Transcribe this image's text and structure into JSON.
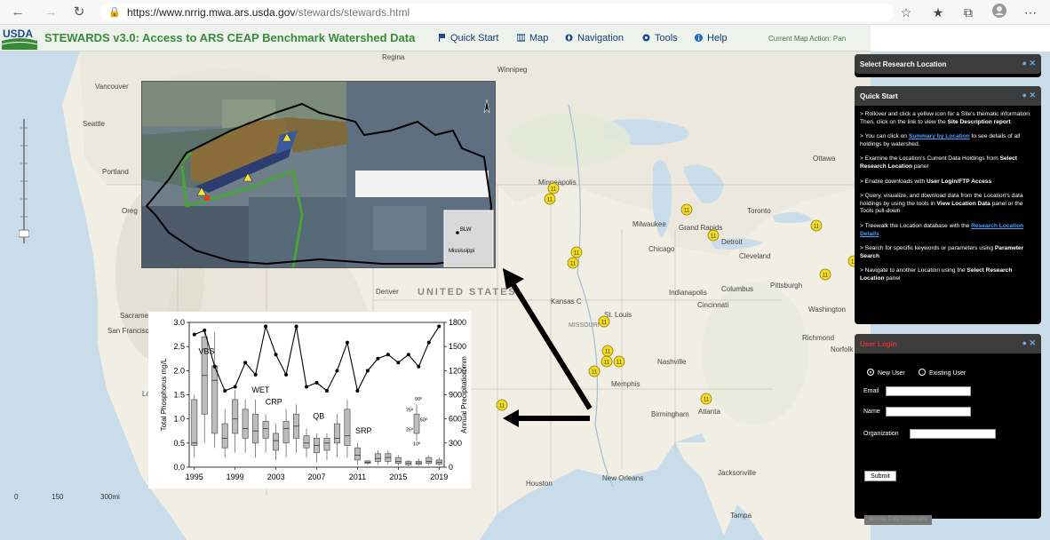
{
  "browser": {
    "url_domain": "https://www.nrrig.mwa.ars.usda.gov",
    "url_path": "/stewards/stewards.html"
  },
  "header": {
    "logo_text": "USDA",
    "title": "STEWARDS v3.0: Access to ARS CEAP Benchmark Watershed Data",
    "menu": [
      {
        "label": "Quick Start",
        "icon": "flag-icon"
      },
      {
        "label": "Map",
        "icon": "map-icon"
      },
      {
        "label": "Navigation",
        "icon": "compass-icon"
      },
      {
        "label": "Tools",
        "icon": "gear-icon"
      },
      {
        "label": "Help",
        "icon": "info-icon"
      }
    ],
    "map_action": "Current Map Action: Pan"
  },
  "map": {
    "labels": {
      "regina": "Regina",
      "winnipeg": "Winnipeg",
      "vancouver": "Vancouver",
      "seattle": "Seattle",
      "portland": "Portland",
      "oregon": "Oreg",
      "minneapolis": "Minneapolis",
      "toronto": "Toronto",
      "ottawa": "Ottawa",
      "milwaukee": "Milwaukee",
      "grand_rapids": "Grand Rapids",
      "detroit": "Detroit",
      "chicago": "Chicago",
      "cleveland": "Cleveland",
      "pittsburgh": "Pittsburgh",
      "columbus": "Columbus",
      "indianapolis": "Indianapolis",
      "cincinnati": "Cincinnati",
      "kansas": "Kansas C",
      "st_louis": "St. Louis",
      "missouri": "MISSOURI",
      "nashville": "Nashville",
      "memphis": "Memphis",
      "atlanta": "Atlanta",
      "birmingham": "Birmingham",
      "washington": "Washington",
      "richmond": "Richmond",
      "norfolk": "Norfolk",
      "jacksonville": "Jacksonville",
      "tampa": "Tampa",
      "new_orleans": "New Orleans",
      "houston": "Houston",
      "denver": "Denver",
      "sacramento": "Sacrame",
      "san_francisco": "San Francisco",
      "los_angeles": "Los An",
      "united_states": "UNITED STATES",
      "miami_blank": ""
    },
    "scale": {
      "zero": "0",
      "mid": "150",
      "end": "300mi"
    }
  },
  "satellite": {
    "label": "BLW",
    "state": "Mississippi"
  },
  "chart_data": {
    "type": "line",
    "title": "",
    "xlabel": "",
    "ylabel": "Total Phosphorus mg/L",
    "y2label": "Annual Precipitation mm",
    "ylim": [
      0,
      3.0
    ],
    "y2lim": [
      0,
      1800
    ],
    "x_ticks": [
      "1995",
      "1999",
      "2003",
      "2007",
      "2011",
      "2015",
      "2019"
    ],
    "y_ticks": [
      "0.0",
      "0.5",
      "1.0",
      "1.5",
      "2.0",
      "2.5",
      "3.0"
    ],
    "y2_ticks": [
      "0",
      "300",
      "600",
      "900",
      "1200",
      "1500",
      "1800"
    ],
    "x": [
      1995,
      1996,
      1997,
      1998,
      1999,
      2000,
      2001,
      2002,
      2003,
      2004,
      2005,
      2006,
      2007,
      2008,
      2009,
      2010,
      2011,
      2012,
      2013,
      2014,
      2015,
      2016,
      2017,
      2018,
      2019
    ],
    "series": [
      {
        "name": "Annual Precipitation",
        "values": [
          1650,
          1700,
          1250,
          950,
          1000,
          1300,
          1150,
          1750,
          1400,
          1150,
          1750,
          1000,
          1050,
          950,
          1200,
          1550,
          950,
          1200,
          1350,
          1400,
          1300,
          1400,
          1250,
          1550,
          1750
        ]
      }
    ],
    "boxes": [
      {
        "x": 1995,
        "q1": 0.45,
        "med": 0.5,
        "q3": 1.4,
        "lo": 0.2,
        "hi": 1.5
      },
      {
        "x": 1996,
        "q1": 1.1,
        "med": 1.9,
        "q3": 2.7,
        "lo": 0.5,
        "hi": 2.8
      },
      {
        "x": 1997,
        "q1": 0.7,
        "med": 1.8,
        "q3": 2.1,
        "lo": 0.4,
        "hi": 2.8
      },
      {
        "x": 1998,
        "q1": 0.4,
        "med": 0.6,
        "q3": 0.9,
        "lo": 0.2,
        "hi": 1.2
      },
      {
        "x": 1999,
        "q1": 0.7,
        "med": 1.0,
        "q3": 1.4,
        "lo": 0.3,
        "hi": 1.6
      },
      {
        "x": 2000,
        "q1": 0.6,
        "med": 0.8,
        "q3": 1.2,
        "lo": 0.3,
        "hi": 1.4
      },
      {
        "x": 2001,
        "q1": 0.5,
        "med": 0.75,
        "q3": 1.1,
        "lo": 0.2,
        "hi": 1.4
      },
      {
        "x": 2002,
        "q1": 0.6,
        "med": 0.8,
        "q3": 0.95,
        "lo": 0.3,
        "hi": 1.1
      },
      {
        "x": 2003,
        "q1": 0.35,
        "med": 0.55,
        "q3": 0.7,
        "lo": 0.15,
        "hi": 0.9
      },
      {
        "x": 2004,
        "q1": 0.5,
        "med": 0.8,
        "q3": 0.95,
        "lo": 0.2,
        "hi": 1.2
      },
      {
        "x": 2005,
        "q1": 0.6,
        "med": 0.85,
        "q3": 1.1,
        "lo": 0.3,
        "hi": 1.3
      },
      {
        "x": 2006,
        "q1": 0.4,
        "med": 0.5,
        "q3": 0.65,
        "lo": 0.2,
        "hi": 0.8
      },
      {
        "x": 2007,
        "q1": 0.3,
        "med": 0.45,
        "q3": 0.6,
        "lo": 0.1,
        "hi": 0.7
      },
      {
        "x": 2008,
        "q1": 0.35,
        "med": 0.5,
        "q3": 0.6,
        "lo": 0.15,
        "hi": 0.7
      },
      {
        "x": 2009,
        "q1": 0.5,
        "med": 0.6,
        "q3": 0.9,
        "lo": 0.2,
        "hi": 1.1
      },
      {
        "x": 2010,
        "q1": 0.45,
        "med": 0.65,
        "q3": 1.2,
        "lo": 0.2,
        "hi": 1.4
      },
      {
        "x": 2011,
        "q1": 0.15,
        "med": 0.25,
        "q3": 0.4,
        "lo": 0.05,
        "hi": 0.5
      },
      {
        "x": 2012,
        "q1": 0.08,
        "med": 0.1,
        "q3": 0.13,
        "lo": 0.05,
        "hi": 0.15
      },
      {
        "x": 2013,
        "q1": 0.12,
        "med": 0.18,
        "q3": 0.28,
        "lo": 0.05,
        "hi": 0.35
      },
      {
        "x": 2014,
        "q1": 0.12,
        "med": 0.2,
        "q3": 0.28,
        "lo": 0.05,
        "hi": 0.35
      },
      {
        "x": 2015,
        "q1": 0.08,
        "med": 0.12,
        "q3": 0.2,
        "lo": 0.03,
        "hi": 0.25
      },
      {
        "x": 2016,
        "q1": 0.05,
        "med": 0.08,
        "q3": 0.12,
        "lo": 0.02,
        "hi": 0.15
      },
      {
        "x": 2017,
        "q1": 0.06,
        "med": 0.09,
        "q3": 0.12,
        "lo": 0.03,
        "hi": 0.18
      },
      {
        "x": 2018,
        "q1": 0.08,
        "med": 0.12,
        "q3": 0.2,
        "lo": 0.03,
        "hi": 0.25
      },
      {
        "x": 2019,
        "q1": 0.06,
        "med": 0.1,
        "q3": 0.15,
        "lo": 0.03,
        "hi": 0.2
      }
    ],
    "annotations": [
      "VBS",
      "WET",
      "CRP",
      "QB",
      "SRP"
    ],
    "legend_box": {
      "p90": "90º",
      "p75": "75º",
      "p50": "50º",
      "p25": "25º",
      "p10": "10º"
    }
  },
  "panels": {
    "select_location": {
      "title": "Select Research Location"
    },
    "quick_start": {
      "title": "Quick Start",
      "items": [
        {
          "a": "> Rollover and click a yellow icon for a Site's thematic information. Then, click on the link to view the ",
          "b": "Site Description report"
        },
        {
          "a": "> You can click on ",
          "link": "Summary by Location",
          "c": " to see details of all holdings by watershed."
        },
        {
          "a": "> Examine the Location's Current Data Holdings from ",
          "b": "Select Research Location",
          "c": " panel"
        },
        {
          "a": "> Enable downloads with ",
          "b": "User Login/FTP Access"
        },
        {
          "a": "> Query, visualize, and download data from the Location's data holdings by using the tools in ",
          "b": "View Location Data",
          "c": " panel or the Tools pull-down"
        },
        {
          "a": "> Treewalk the Location database with the ",
          "link": "Research Location Details"
        },
        {
          "a": "> Search for specific keywords or parameters using ",
          "b": "Parameter Search"
        },
        {
          "a": "> Navigate to another Location using the ",
          "b": "Select Research Location",
          "c": " panel"
        }
      ]
    },
    "login": {
      "title": "User Login",
      "radio_new": "New User",
      "radio_existing": "Existing User",
      "email": "Email",
      "name": "Name",
      "organization": "Organization",
      "submit": "Submit",
      "disabled_button": "Access Data Downloads"
    }
  },
  "colors": {
    "map_water": "#c9dcea",
    "map_land": "#f1eee4",
    "title_green": "#3a8a3a",
    "site_marker": "#f2dc1d",
    "login_title": "#e03030"
  }
}
